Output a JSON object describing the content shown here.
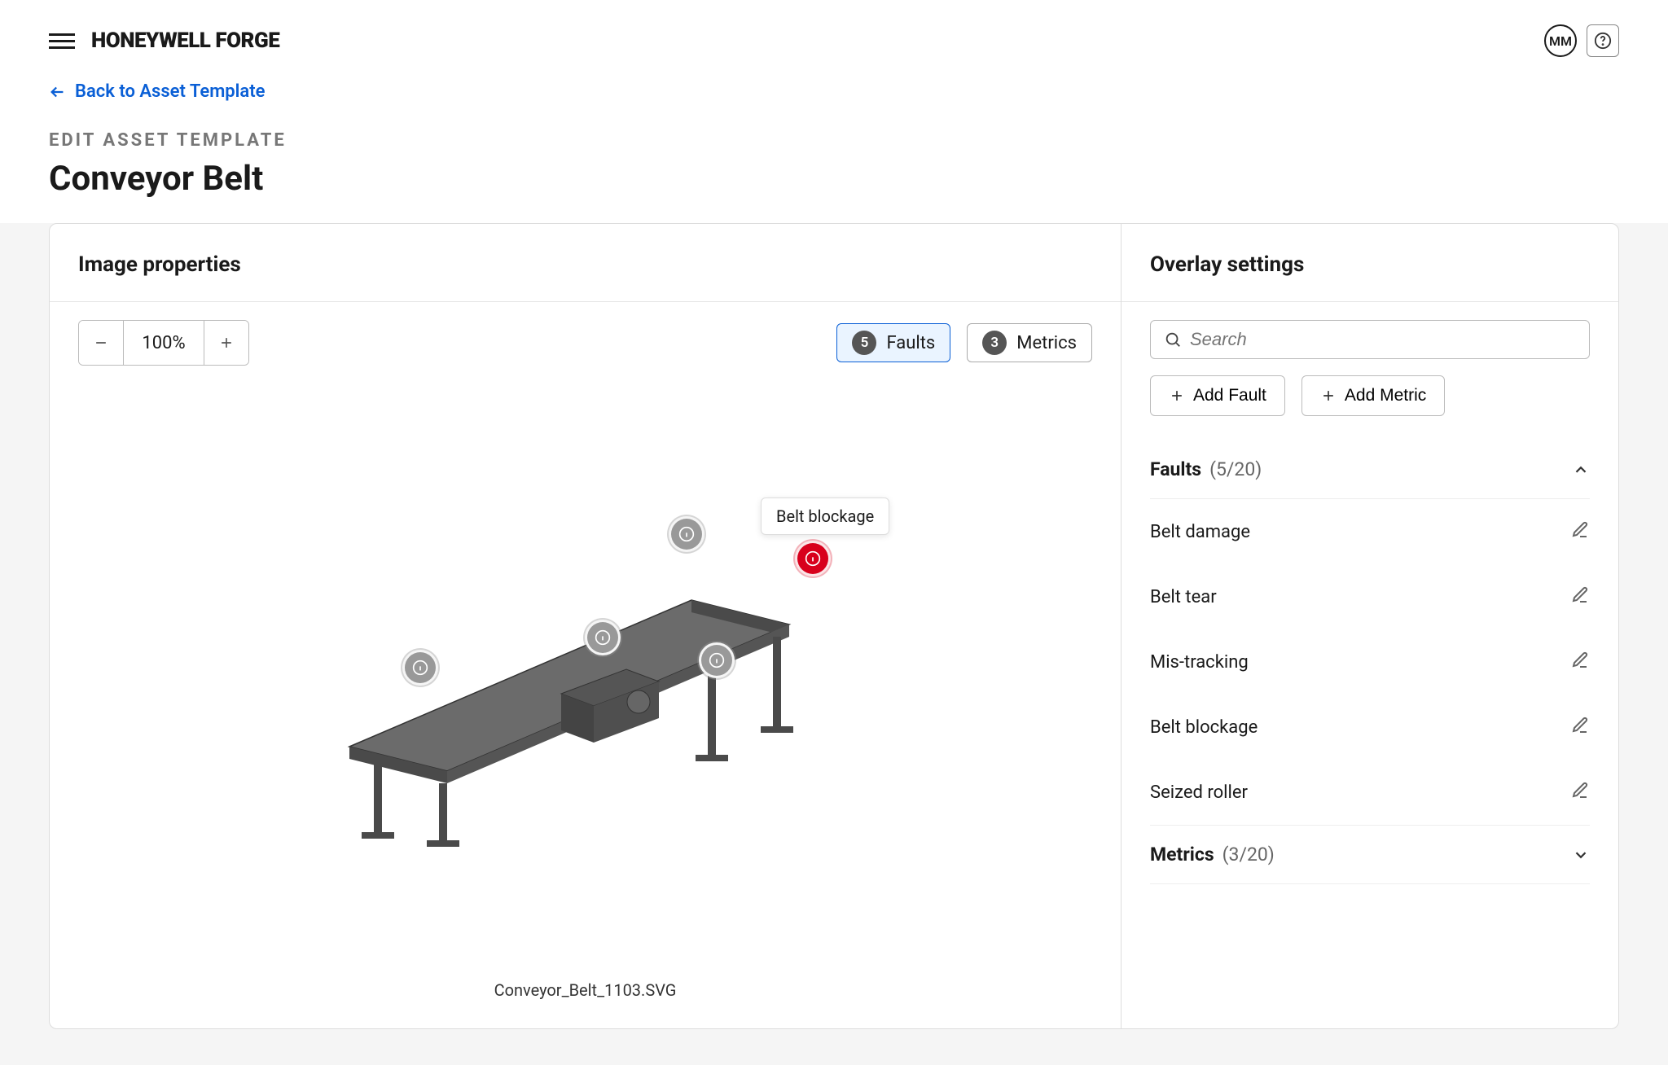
{
  "header": {
    "brand": "HONEYWELL FORGE",
    "user_initials": "MM"
  },
  "subheader": {
    "back_label": "Back to Asset Template",
    "overline": "EDIT ASSET TEMPLATE",
    "title": "Conveyor Belt"
  },
  "left_panel": {
    "title": "Image properties",
    "zoom_value": "100%",
    "toggles": {
      "faults_count": "5",
      "faults_label": "Faults",
      "metrics_count": "3",
      "metrics_label": "Metrics"
    },
    "filename": "Conveyor_Belt_1103.SVG",
    "tooltip": "Belt blockage"
  },
  "right_panel": {
    "title": "Overlay settings",
    "search_placeholder": "Search",
    "add_fault": "Add Fault",
    "add_metric": "Add Metric",
    "faults_section": {
      "label": "Faults",
      "count": "(5/20)",
      "items": [
        "Belt damage",
        "Belt tear",
        "Mis-tracking",
        "Belt blockage",
        "Seized roller"
      ]
    },
    "metrics_section": {
      "label": "Metrics",
      "count": "(3/20)"
    }
  }
}
